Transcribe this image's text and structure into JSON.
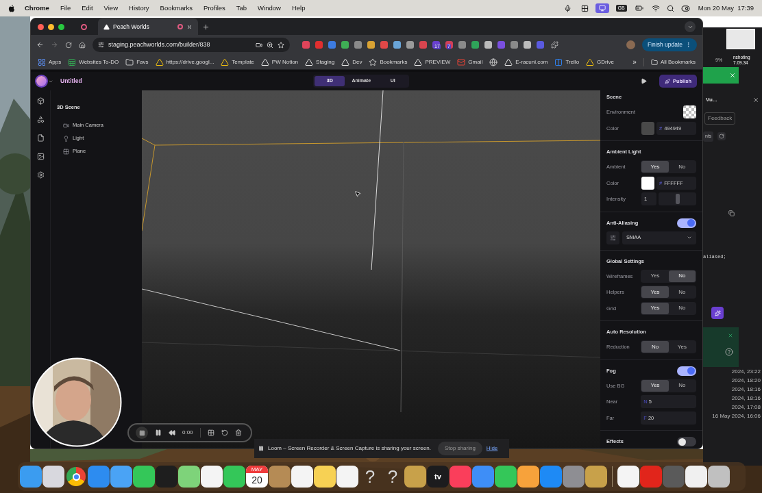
{
  "menubar": {
    "app": "Chrome",
    "menus": [
      "File",
      "Edit",
      "View",
      "History",
      "Bookmarks",
      "Profiles",
      "Tab",
      "Window",
      "Help"
    ],
    "keyboard": "GB",
    "clock": "Mon 20 May  17:39"
  },
  "browser": {
    "tabs": [
      {
        "title": "Peach Worlds",
        "selected": true
      }
    ],
    "url": "staging.peachworlds.com/builder/838",
    "extensions": [
      {
        "color": "#e0445a"
      },
      {
        "color": "#e02f2f"
      },
      {
        "color": "#3d7be0"
      },
      {
        "color": "#3fae55"
      },
      {
        "color": "#8a8a8a"
      },
      {
        "color": "#d9a233"
      },
      {
        "color": "#e04848"
      },
      {
        "color": "#6aa5d8"
      },
      {
        "color": "#9a9a9a"
      },
      {
        "color": "#d9454f"
      },
      {
        "color": "#6a3fd0",
        "badge": "17"
      },
      {
        "color": "#d0405a",
        "badge": "7"
      },
      {
        "color": "#8a8a8a"
      },
      {
        "color": "#2fa45a"
      },
      {
        "color": "#bbbbbb"
      },
      {
        "color": "#7a4fe0"
      },
      {
        "color": "#8a8a8a"
      },
      {
        "color": "#bbbbbb"
      },
      {
        "color": "#5a5ae0"
      }
    ],
    "update_button": "Finish update",
    "bookmarks": [
      {
        "label": "Apps",
        "kind": "grid"
      },
      {
        "label": "Websites To-DO",
        "kind": "sheet"
      },
      {
        "label": "Favs",
        "kind": "folder"
      },
      {
        "label": "https://drive.googl...",
        "kind": "drive"
      },
      {
        "label": "Template",
        "kind": "drive"
      },
      {
        "label": "PW Notion",
        "kind": "site"
      },
      {
        "label": "Staging",
        "kind": "site"
      },
      {
        "label": "Dev",
        "kind": "site"
      },
      {
        "label": "Bookmarks",
        "kind": "star"
      },
      {
        "label": "PREVIEW",
        "kind": "site"
      },
      {
        "label": "Gmail",
        "kind": "mail"
      },
      {
        "kind": "globe"
      },
      {
        "label": "E-racuni.com",
        "kind": "site"
      },
      {
        "label": "Trello",
        "kind": "board"
      },
      {
        "label": "GDrive",
        "kind": "drive"
      }
    ],
    "bookmarks_overflow": "»",
    "all_bookmarks": "All Bookmarks"
  },
  "app": {
    "title": "Untitled",
    "modes": [
      {
        "label": "3D",
        "selected": true
      },
      {
        "label": "Animate",
        "selected": false
      },
      {
        "label": "UI",
        "selected": false
      }
    ],
    "publish": "Publish",
    "outline": {
      "title": "3D Scene",
      "children": [
        {
          "label": "Main Camera",
          "kind": "camera"
        },
        {
          "label": "Light",
          "kind": "light"
        },
        {
          "label": "Plane",
          "kind": "plane"
        }
      ]
    },
    "inspector": [
      {
        "title": "Scene",
        "rows": [
          {
            "kind": "checker",
            "label": "Environment"
          },
          {
            "kind": "color",
            "label": "Color",
            "color": "#494949",
            "prefix": "#",
            "value": "494949"
          }
        ]
      },
      {
        "title": "Ambient Light",
        "rows": [
          {
            "kind": "choice",
            "label": "Ambient",
            "options": [
              {
                "label": "Yes",
                "selected": true
              },
              {
                "label": "No",
                "selected": false
              }
            ]
          },
          {
            "kind": "color",
            "label": "Color",
            "color": "#ffffff",
            "prefix": "#",
            "value": "FFFFFF"
          },
          {
            "kind": "slider",
            "label": "Intensity",
            "value": "1",
            "level": 0.5
          }
        ]
      },
      {
        "title": "Anti-Aliasing",
        "on": true,
        "rows": [
          {
            "kind": "select",
            "value": "SMAA"
          }
        ]
      },
      {
        "title": "Global Settings",
        "rows": [
          {
            "kind": "choice",
            "label": "Wireframes",
            "options": [
              {
                "label": "Yes",
                "selected": false
              },
              {
                "label": "No",
                "selected": true
              }
            ]
          },
          {
            "kind": "choice",
            "label": "Helpers",
            "options": [
              {
                "label": "Yes",
                "selected": true
              },
              {
                "label": "No",
                "selected": false
              }
            ]
          },
          {
            "kind": "choice",
            "label": "Grid",
            "options": [
              {
                "label": "Yes",
                "selected": true
              },
              {
                "label": "No",
                "selected": false
              }
            ]
          }
        ]
      },
      {
        "title": "Auto Resolution",
        "rows": [
          {
            "kind": "choice",
            "label": "Reduction",
            "options": [
              {
                "label": "No",
                "selected": true
              },
              {
                "label": "Yes",
                "selected": false
              }
            ]
          }
        ]
      },
      {
        "title": "Fog",
        "on": true,
        "rows": [
          {
            "kind": "choice",
            "label": "Use BG",
            "options": [
              {
                "label": "Yes",
                "selected": true
              },
              {
                "label": "No",
                "selected": false
              }
            ]
          },
          {
            "kind": "number",
            "label": "Near",
            "prefix": "N",
            "value": "5"
          },
          {
            "kind": "number",
            "label": "Far",
            "prefix": "F",
            "value": "20"
          }
        ]
      },
      {
        "title": "Effects",
        "on": false
      }
    ]
  },
  "loom": {
    "timer": "0:00",
    "message": "Loom – Screen Recorder & Screen Capture is sharing your screen.",
    "stop": "Stop sharing",
    "hide": "Hide"
  },
  "background_window": {
    "battery": "9%",
    "thumbnail_caption": "nshoting 7.09.34",
    "title": "Vu...",
    "feedback": "Feedback",
    "tab": "nts",
    "code": "aliased;",
    "dates": [
      "2024, 23:22",
      "2024, 18:20",
      "2024, 18:16",
      "2024, 18:16",
      "2024, 17:08",
      "16 May 2024, 16:06"
    ]
  },
  "dock": [
    {
      "kind": "app",
      "color": "#3b9cf0"
    },
    {
      "kind": "app",
      "color": "#d8d8de"
    },
    {
      "kind": "chrome"
    },
    {
      "kind": "app",
      "color": "#2d8cf0"
    },
    {
      "kind": "app",
      "color": "#4aa3f5"
    },
    {
      "kind": "app",
      "color": "#34c759"
    },
    {
      "kind": "app",
      "color": "#1e1e1e"
    },
    {
      "kind": "app",
      "color": "#7ed37a"
    },
    {
      "kind": "app",
      "color": "#f4f4f4"
    },
    {
      "kind": "app",
      "color": "#34c759"
    },
    {
      "kind": "calendar",
      "month": "MAY",
      "day": "20"
    },
    {
      "kind": "app",
      "color": "#b58b55"
    },
    {
      "kind": "app",
      "color": "#f4f4f4"
    },
    {
      "kind": "app",
      "color": "#f7d154"
    },
    {
      "kind": "app",
      "color": "#f4f4f4"
    },
    {
      "kind": "glyph",
      "text": "?"
    },
    {
      "kind": "glyph",
      "text": "?"
    },
    {
      "kind": "app",
      "color": "#c8a14a"
    },
    {
      "kind": "tv",
      "text": "tv"
    },
    {
      "kind": "app",
      "color": "#fa3e5b"
    },
    {
      "kind": "app",
      "color": "#3e8ef7"
    },
    {
      "kind": "app",
      "color": "#34c759"
    },
    {
      "kind": "app",
      "color": "#f7a23b"
    },
    {
      "kind": "app",
      "color": "#1e8af5"
    },
    {
      "kind": "app",
      "color": "#8e8e93"
    },
    {
      "kind": "app",
      "color": "#c8a14a"
    },
    {
      "kind": "separator"
    },
    {
      "kind": "app",
      "color": "#f4f4f4"
    },
    {
      "kind": "app",
      "color": "#e1251b"
    },
    {
      "kind": "app",
      "color": "#5a5a5a"
    },
    {
      "kind": "app",
      "color": "#f0f0f0"
    },
    {
      "kind": "app",
      "color": "#c0c0c0"
    }
  ]
}
